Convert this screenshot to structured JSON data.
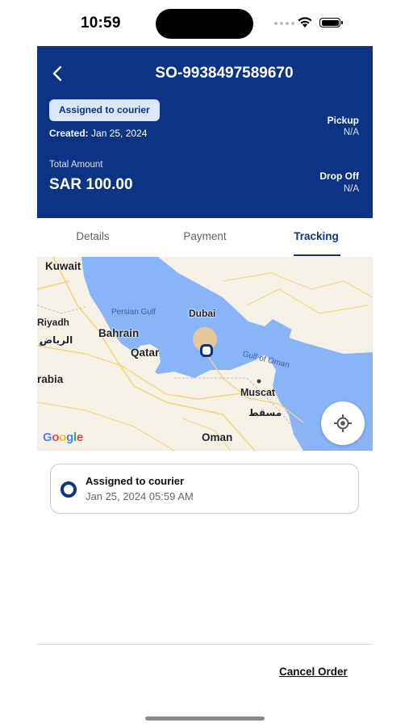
{
  "status_bar": {
    "time": "10:59"
  },
  "header": {
    "order_id": "SO-9938497589670",
    "status_badge": "Assigned to courier",
    "created_label": "Created:",
    "created_date": "Jan 25, 2024",
    "pickup_label": "Pickup",
    "pickup_value": "N/A",
    "total_label": "Total Amount",
    "total_value": "SAR 100.00",
    "dropoff_label": "Drop Off",
    "dropoff_value": "N/A"
  },
  "tabs": [
    {
      "label": "Details",
      "active": false
    },
    {
      "label": "Payment",
      "active": false
    },
    {
      "label": "Tracking",
      "active": true
    }
  ],
  "map": {
    "labels": {
      "kuwait": "Kuwait",
      "riyadh": "Riyadh",
      "riyadh_ar": "الرياض",
      "bahrain": "Bahrain",
      "qatar": "Qatar",
      "dubai": "Dubai",
      "persian_gulf": "Persian Gulf",
      "gulf_of_oman": "Gulf of Oman",
      "muscat": "Muscat",
      "muscat_ar": "مسقط",
      "arabia": "rabia",
      "oman": "Oman"
    },
    "attribution": "Google",
    "colors": {
      "water": "#8ab4f8",
      "land": "#f6f1e6",
      "roads": "#f3d37c"
    }
  },
  "timeline": [
    {
      "title": "Assigned to courier",
      "time": "Jan 25, 2024 05:59 AM"
    }
  ],
  "footer": {
    "cancel_label": "Cancel Order"
  },
  "colors": {
    "primary": "#0d3384",
    "badge_bg": "#dbe7fb"
  }
}
